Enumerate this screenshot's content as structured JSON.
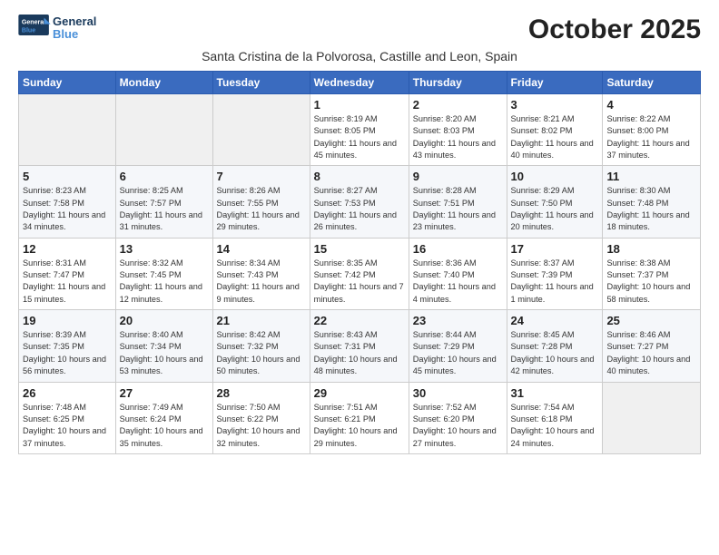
{
  "header": {
    "logo_general": "General",
    "logo_blue": "Blue",
    "month_title": "October 2025",
    "subtitle": "Santa Cristina de la Polvorosa, Castille and Leon, Spain"
  },
  "weekdays": [
    "Sunday",
    "Monday",
    "Tuesday",
    "Wednesday",
    "Thursday",
    "Friday",
    "Saturday"
  ],
  "weeks": [
    [
      {
        "day": "",
        "empty": true
      },
      {
        "day": "",
        "empty": true
      },
      {
        "day": "",
        "empty": true
      },
      {
        "day": "1",
        "sunrise": "8:19 AM",
        "sunset": "8:05 PM",
        "daylight": "11 hours and 45 minutes."
      },
      {
        "day": "2",
        "sunrise": "8:20 AM",
        "sunset": "8:03 PM",
        "daylight": "11 hours and 43 minutes."
      },
      {
        "day": "3",
        "sunrise": "8:21 AM",
        "sunset": "8:02 PM",
        "daylight": "11 hours and 40 minutes."
      },
      {
        "day": "4",
        "sunrise": "8:22 AM",
        "sunset": "8:00 PM",
        "daylight": "11 hours and 37 minutes."
      }
    ],
    [
      {
        "day": "5",
        "sunrise": "8:23 AM",
        "sunset": "7:58 PM",
        "daylight": "11 hours and 34 minutes."
      },
      {
        "day": "6",
        "sunrise": "8:25 AM",
        "sunset": "7:57 PM",
        "daylight": "11 hours and 31 minutes."
      },
      {
        "day": "7",
        "sunrise": "8:26 AM",
        "sunset": "7:55 PM",
        "daylight": "11 hours and 29 minutes."
      },
      {
        "day": "8",
        "sunrise": "8:27 AM",
        "sunset": "7:53 PM",
        "daylight": "11 hours and 26 minutes."
      },
      {
        "day": "9",
        "sunrise": "8:28 AM",
        "sunset": "7:51 PM",
        "daylight": "11 hours and 23 minutes."
      },
      {
        "day": "10",
        "sunrise": "8:29 AM",
        "sunset": "7:50 PM",
        "daylight": "11 hours and 20 minutes."
      },
      {
        "day": "11",
        "sunrise": "8:30 AM",
        "sunset": "7:48 PM",
        "daylight": "11 hours and 18 minutes."
      }
    ],
    [
      {
        "day": "12",
        "sunrise": "8:31 AM",
        "sunset": "7:47 PM",
        "daylight": "11 hours and 15 minutes."
      },
      {
        "day": "13",
        "sunrise": "8:32 AM",
        "sunset": "7:45 PM",
        "daylight": "11 hours and 12 minutes."
      },
      {
        "day": "14",
        "sunrise": "8:34 AM",
        "sunset": "7:43 PM",
        "daylight": "11 hours and 9 minutes."
      },
      {
        "day": "15",
        "sunrise": "8:35 AM",
        "sunset": "7:42 PM",
        "daylight": "11 hours and 7 minutes."
      },
      {
        "day": "16",
        "sunrise": "8:36 AM",
        "sunset": "7:40 PM",
        "daylight": "11 hours and 4 minutes."
      },
      {
        "day": "17",
        "sunrise": "8:37 AM",
        "sunset": "7:39 PM",
        "daylight": "11 hours and 1 minute."
      },
      {
        "day": "18",
        "sunrise": "8:38 AM",
        "sunset": "7:37 PM",
        "daylight": "10 hours and 58 minutes."
      }
    ],
    [
      {
        "day": "19",
        "sunrise": "8:39 AM",
        "sunset": "7:35 PM",
        "daylight": "10 hours and 56 minutes."
      },
      {
        "day": "20",
        "sunrise": "8:40 AM",
        "sunset": "7:34 PM",
        "daylight": "10 hours and 53 minutes."
      },
      {
        "day": "21",
        "sunrise": "8:42 AM",
        "sunset": "7:32 PM",
        "daylight": "10 hours and 50 minutes."
      },
      {
        "day": "22",
        "sunrise": "8:43 AM",
        "sunset": "7:31 PM",
        "daylight": "10 hours and 48 minutes."
      },
      {
        "day": "23",
        "sunrise": "8:44 AM",
        "sunset": "7:29 PM",
        "daylight": "10 hours and 45 minutes."
      },
      {
        "day": "24",
        "sunrise": "8:45 AM",
        "sunset": "7:28 PM",
        "daylight": "10 hours and 42 minutes."
      },
      {
        "day": "25",
        "sunrise": "8:46 AM",
        "sunset": "7:27 PM",
        "daylight": "10 hours and 40 minutes."
      }
    ],
    [
      {
        "day": "26",
        "sunrise": "7:48 AM",
        "sunset": "6:25 PM",
        "daylight": "10 hours and 37 minutes."
      },
      {
        "day": "27",
        "sunrise": "7:49 AM",
        "sunset": "6:24 PM",
        "daylight": "10 hours and 35 minutes."
      },
      {
        "day": "28",
        "sunrise": "7:50 AM",
        "sunset": "6:22 PM",
        "daylight": "10 hours and 32 minutes."
      },
      {
        "day": "29",
        "sunrise": "7:51 AM",
        "sunset": "6:21 PM",
        "daylight": "10 hours and 29 minutes."
      },
      {
        "day": "30",
        "sunrise": "7:52 AM",
        "sunset": "6:20 PM",
        "daylight": "10 hours and 27 minutes."
      },
      {
        "day": "31",
        "sunrise": "7:54 AM",
        "sunset": "6:18 PM",
        "daylight": "10 hours and 24 minutes."
      },
      {
        "day": "",
        "empty": true
      }
    ]
  ]
}
